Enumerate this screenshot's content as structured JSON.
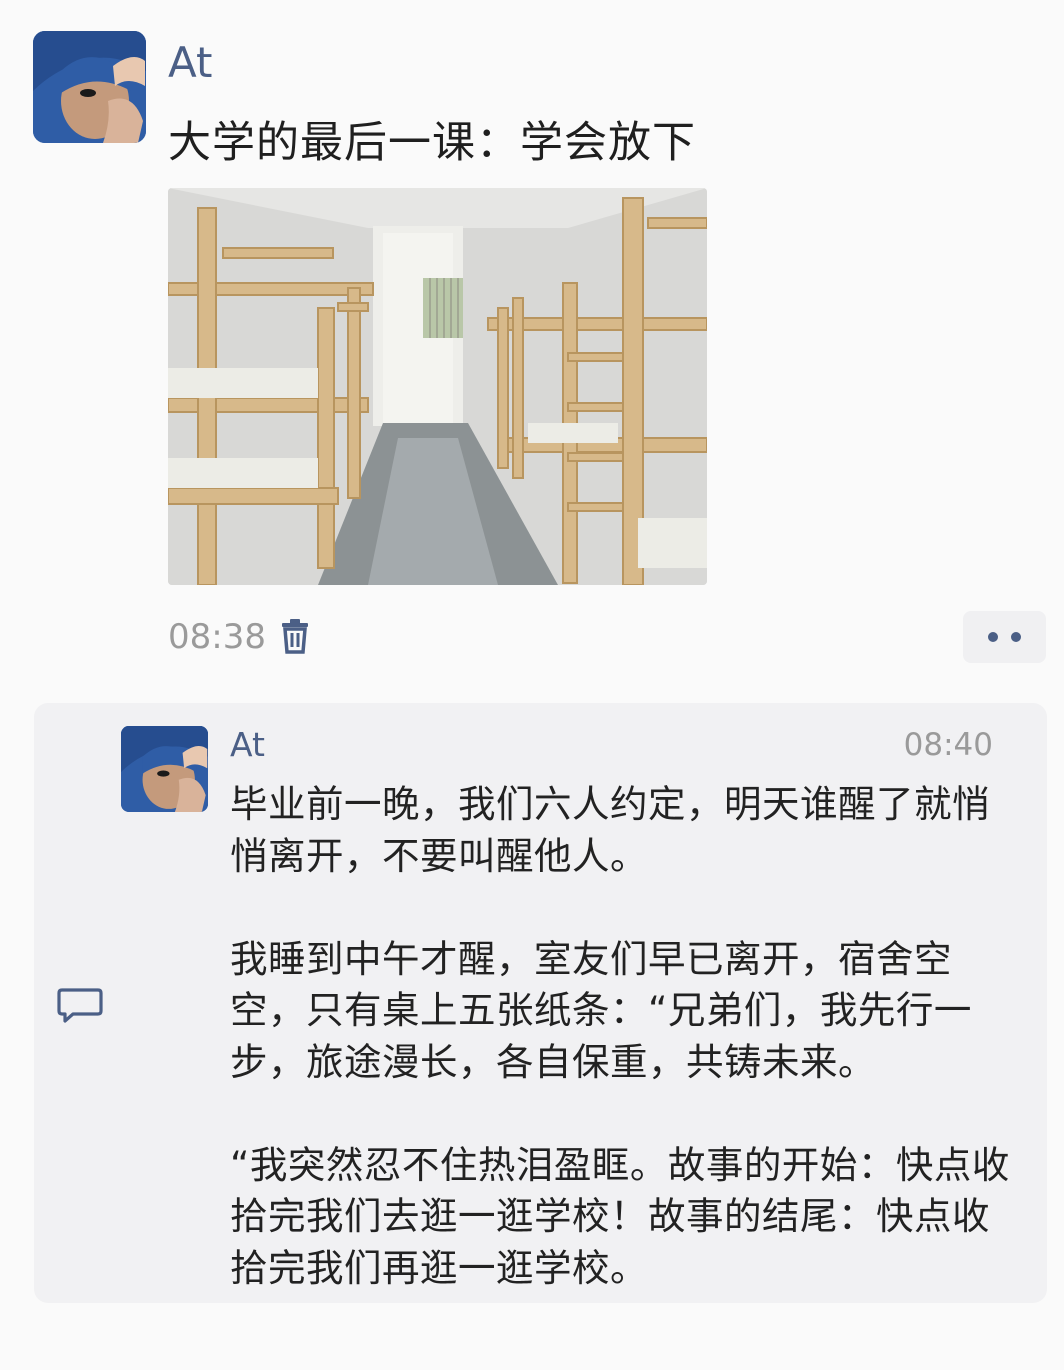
{
  "post": {
    "author": "At",
    "text": "大学的最后一课：学会放下",
    "image_alt": "empty dorm room with wooden bunk beds",
    "time": "08:38",
    "icons": {
      "delete": "trash-icon",
      "more": "more-dots-icon"
    }
  },
  "comment": {
    "author": "At",
    "time": "08:40",
    "paragraphs": [
      "毕业前一晚，我们六人约定，明天谁醒了就悄悄离开，不要叫醒他人。",
      "我睡到中午才醒，室友们早已离开，宿舍空空，只有桌上五张纸条：“兄弟们，我先行一步，旅途漫长，各自保重，共铸未来。",
      "“我突然忍不住热泪盈眶。故事的开始：快点收拾完我们去逛一逛学校！故事的结尾：快点收拾完我们再逛一逛学校。"
    ],
    "icons": {
      "comment": "comment-bubble-icon"
    }
  },
  "colors": {
    "name": "#4b5f86",
    "background": "#fafafa",
    "comment_bg": "#f1f1f3",
    "timestamp": "#9a9a9a"
  }
}
